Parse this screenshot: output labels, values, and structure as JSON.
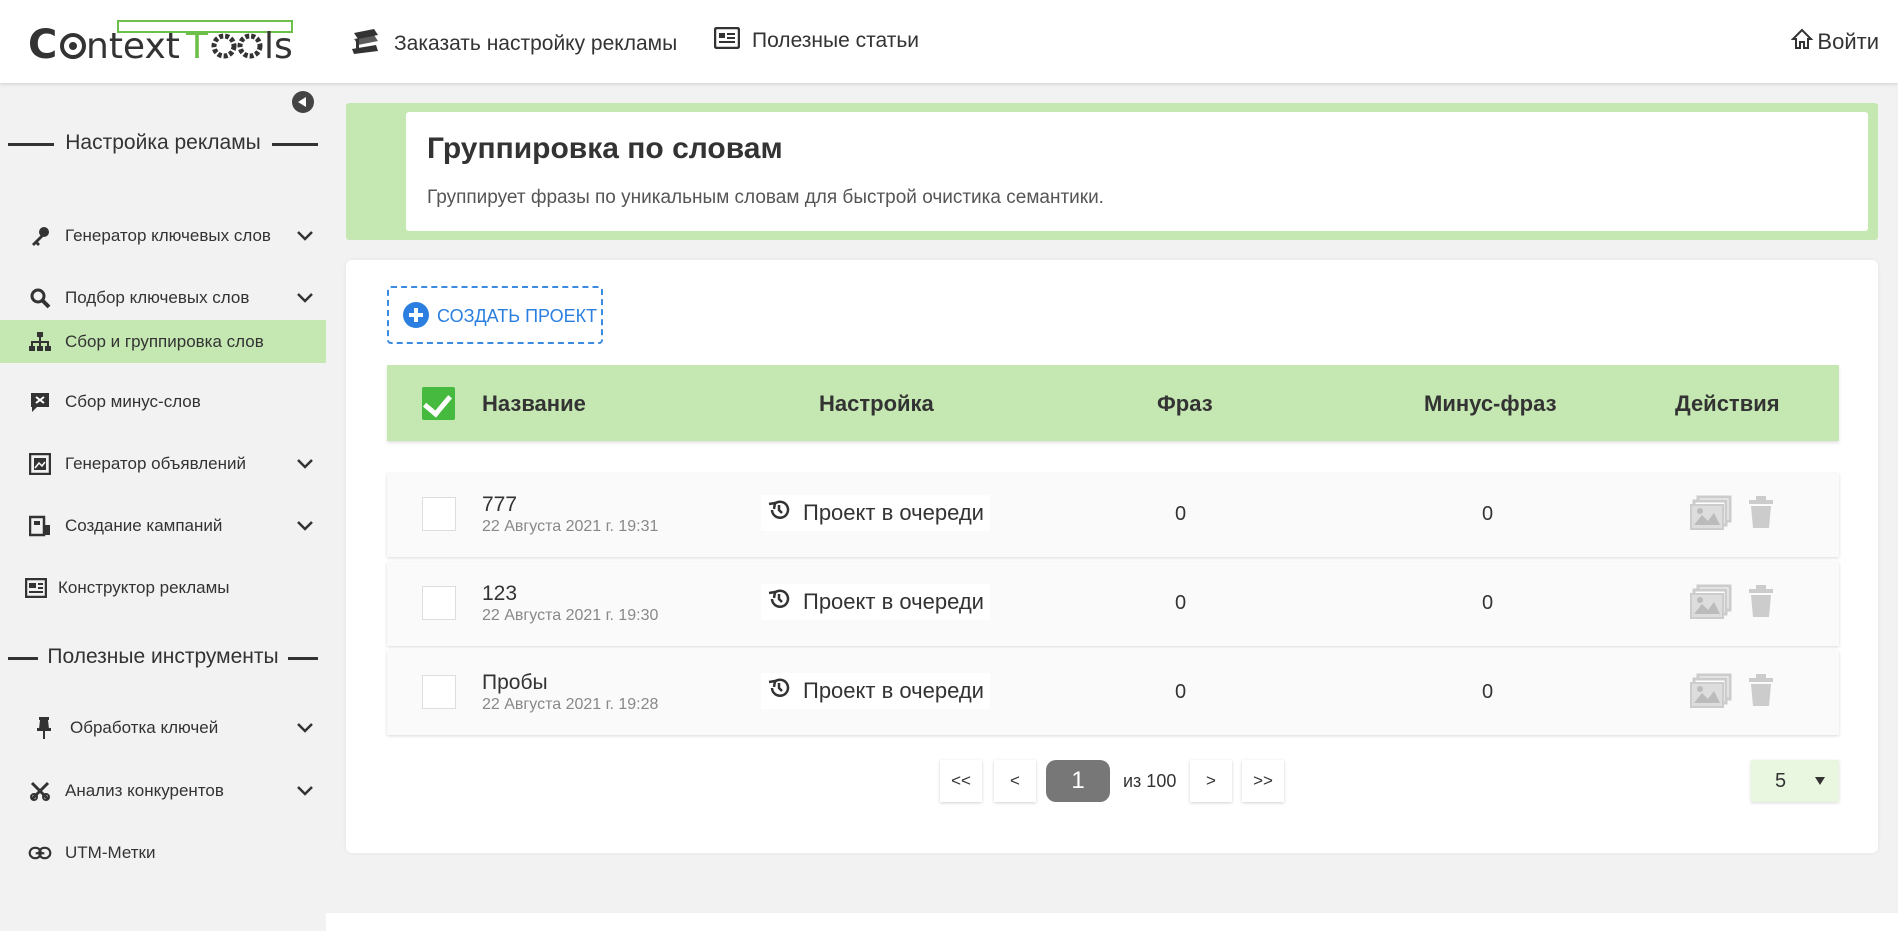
{
  "header": {
    "logo_text": "ContextTools",
    "nav": [
      {
        "label": "Заказать настройку рекламы",
        "icon": "stack-icon"
      },
      {
        "label": "Полезные статьи",
        "icon": "article-icon"
      }
    ],
    "login_label": "Войти"
  },
  "sidebar": {
    "section_ads": "Настройка рекламы",
    "section_tools": "Полезные инструменты",
    "items": [
      {
        "label": "Генератор ключевых слов",
        "icon": "key-icon",
        "expandable": true
      },
      {
        "label": "Подбор ключевых слов",
        "icon": "search-icon",
        "expandable": true
      },
      {
        "label": "Сбор и группировка слов",
        "icon": "sitemap-icon",
        "active": true
      },
      {
        "label": "Сбор минус-слов",
        "icon": "minus-comment-icon"
      },
      {
        "label": "Генератор объявлений",
        "icon": "image-frame-icon",
        "expandable": true
      },
      {
        "label": "Создание кампаний",
        "icon": "building-icon",
        "expandable": true
      },
      {
        "label": "Конструктор рекламы",
        "icon": "layout-icon"
      },
      {
        "label": "Обработка ключей",
        "icon": "pin-icon",
        "expandable": true
      },
      {
        "label": "Анализ конкурентов",
        "icon": "crossed-icon",
        "expandable": true
      },
      {
        "label": "UTM-Метки",
        "icon": "link-icon"
      }
    ]
  },
  "banner": {
    "title": "Группировка по словам",
    "description": "Группирует фразы по уникальным словам для быстрой очистика семантики."
  },
  "create_button": "СОЗДАТЬ ПРОЕКТ",
  "table": {
    "headers": {
      "name": "Название",
      "setting": "Настройка",
      "phrases": "Фраз",
      "minus": "Минус-фраз",
      "actions": "Действия"
    },
    "rows": [
      {
        "name": "777",
        "date": "22 Августа 2021 г. 19:31",
        "status": "Проект в очереди",
        "phrases": "0",
        "minus": "0"
      },
      {
        "name": "123",
        "date": "22 Августа 2021 г. 19:30",
        "status": "Проект в очереди",
        "phrases": "0",
        "minus": "0"
      },
      {
        "name": "Пробы",
        "date": "22 Августа 2021 г. 19:28",
        "status": "Проект в очереди",
        "phrases": "0",
        "minus": "0"
      }
    ]
  },
  "pagination": {
    "first": "<<",
    "prev": "<",
    "current": "1",
    "of_total": "из 100",
    "next": ">",
    "last": ">>",
    "per_page": "5"
  },
  "colors": {
    "accent_green": "#c5e8b2",
    "check_green": "#46b93f",
    "link_blue": "#2b7fe0"
  }
}
